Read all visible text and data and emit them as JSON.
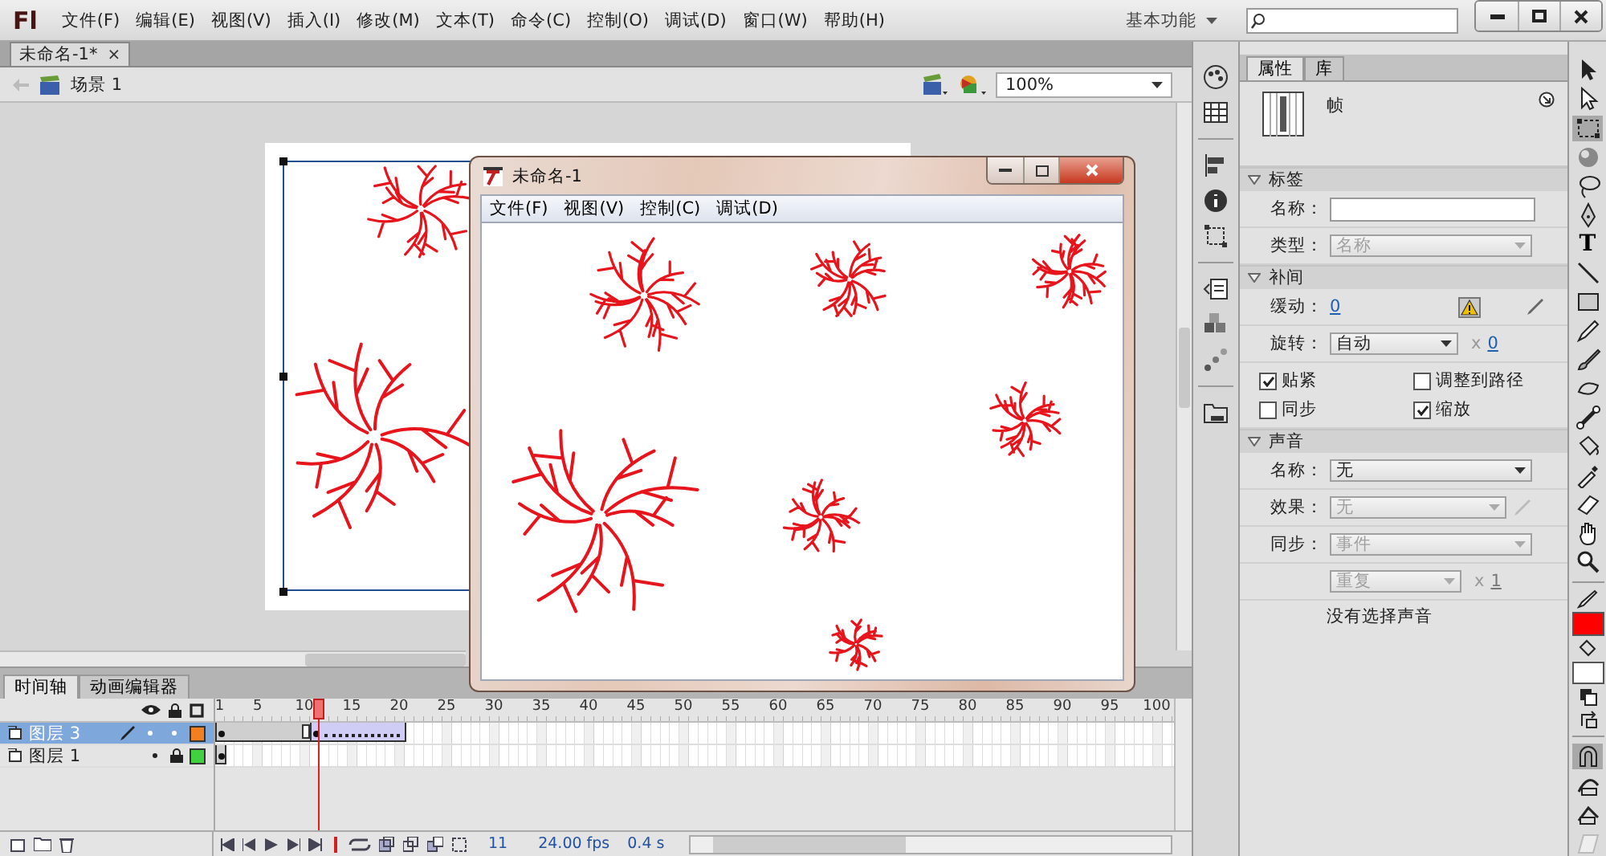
{
  "app": {
    "logo": "Fl",
    "menus": [
      "文件(F)",
      "编辑(E)",
      "视图(V)",
      "插入(I)",
      "修改(M)",
      "文本(T)",
      "命令(C)",
      "控制(O)",
      "调试(D)",
      "窗口(W)",
      "帮助(H)"
    ],
    "workspace": "基本功能"
  },
  "document_tab": {
    "title": "未命名-1*",
    "close": "×"
  },
  "scene_bar": {
    "scene": "场景 1",
    "zoom": "100%"
  },
  "player_window": {
    "title": "未命名-1",
    "menus": [
      "文件(F)",
      "视图(V)",
      "控制(C)",
      "调试(D)"
    ]
  },
  "timeline": {
    "tabs": [
      {
        "label": "时间轴",
        "selected": true
      },
      {
        "label": "动画编辑器",
        "selected": false
      }
    ],
    "frame_numbers": [
      "1",
      "5",
      "10",
      "15",
      "20",
      "25",
      "30",
      "35",
      "40",
      "45",
      "50",
      "55",
      "60",
      "65",
      "70",
      "75",
      "80",
      "85",
      "90",
      "95",
      "100"
    ],
    "layers": [
      {
        "name": "图层 3",
        "selected": true,
        "locked": false,
        "color": "#f08020",
        "frames": [
          {
            "kind": "key"
          },
          {
            "kind": "span"
          },
          {
            "kind": "span"
          },
          {
            "kind": "span"
          },
          {
            "kind": "span"
          },
          {
            "kind": "span"
          },
          {
            "kind": "span"
          },
          {
            "kind": "span"
          },
          {
            "kind": "span"
          },
          {
            "kind": "end"
          },
          {
            "kind": "tween_key"
          },
          {
            "kind": "tween"
          },
          {
            "kind": "tween"
          },
          {
            "kind": "tween"
          },
          {
            "kind": "tween"
          },
          {
            "kind": "tween"
          },
          {
            "kind": "tween"
          },
          {
            "kind": "tween"
          },
          {
            "kind": "tween"
          },
          {
            "kind": "tween"
          }
        ]
      },
      {
        "name": "图层 1",
        "selected": false,
        "locked": true,
        "color": "#40d040",
        "frames": [
          {
            "kind": "key"
          }
        ]
      }
    ],
    "current_frame": "11",
    "frame_rate": "24.00 fps",
    "elapsed": "0.4 s"
  },
  "properties": {
    "tabs": [
      {
        "label": "属性",
        "selected": true
      },
      {
        "label": "库",
        "selected": false
      }
    ],
    "selection": "帧",
    "sections": [
      {
        "title": "标签",
        "expanded": true,
        "rows": [
          {
            "kind": "input",
            "label": "名称："
          },
          {
            "kind": "select",
            "label": "类型：",
            "value": "名称",
            "disabled": true
          }
        ]
      },
      {
        "title": "补间",
        "expanded": true,
        "rows": [
          {
            "kind": "ease",
            "label": "缓动：",
            "value": "0"
          },
          {
            "kind": "select",
            "label": "旋转：",
            "value": "自动",
            "disabled": false,
            "times": "x",
            "count": "0"
          },
          {
            "kind": "checks",
            "items": [
              {
                "label": "贴紧",
                "checked": true
              },
              {
                "label": "调整到路径",
                "checked": false
              },
              {
                "label": "同步",
                "checked": false
              },
              {
                "label": "缩放",
                "checked": true
              }
            ]
          }
        ]
      },
      {
        "title": "声音",
        "expanded": true,
        "rows": [
          {
            "kind": "select",
            "label": "名称：",
            "value": "无",
            "disabled": false
          },
          {
            "kind": "select",
            "label": "效果：",
            "value": "无",
            "disabled": true,
            "edit": true
          },
          {
            "kind": "select",
            "label": "同步：",
            "value": "事件",
            "disabled": true
          },
          {
            "kind": "select",
            "value": "重复",
            "disabled": true,
            "times": "x",
            "count": "1"
          },
          {
            "kind": "note",
            "text": "没有选择声音"
          }
        ]
      }
    ]
  },
  "tools": {
    "items": [
      {
        "kind": "arrow",
        "selected": false
      },
      {
        "kind": "subselect",
        "selected": false
      },
      {
        "kind": "transform",
        "selected": true
      },
      {
        "kind": "sphere",
        "selected": false
      },
      {
        "kind": "lasso",
        "selected": false
      },
      {
        "kind": "pen",
        "selected": false
      },
      {
        "kind": "text",
        "glyph": "T",
        "selected": false
      },
      {
        "kind": "line",
        "selected": false
      },
      {
        "kind": "rectangle",
        "selected": false
      },
      {
        "kind": "pencil",
        "selected": false
      },
      {
        "kind": "brush",
        "selected": false
      },
      {
        "kind": "deco",
        "selected": false
      },
      {
        "kind": "bone",
        "selected": false
      },
      {
        "kind": "bucket",
        "selected": false
      },
      {
        "kind": "eyedropper",
        "selected": false
      },
      {
        "kind": "eraser",
        "selected": false
      },
      {
        "kind": "hand",
        "selected": false
      },
      {
        "kind": "zoom",
        "selected": false
      }
    ],
    "swatches": [
      {
        "kind": "stroke",
        "color": "#ff0000"
      },
      {
        "kind": "fill",
        "color": "#ffffff"
      }
    ],
    "options": [
      {
        "kind": "snap",
        "selected": true
      },
      {
        "kind": "smooth",
        "selected": false
      },
      {
        "kind": "straighten",
        "selected": false
      },
      {
        "kind": "dim",
        "selected": false
      }
    ]
  }
}
